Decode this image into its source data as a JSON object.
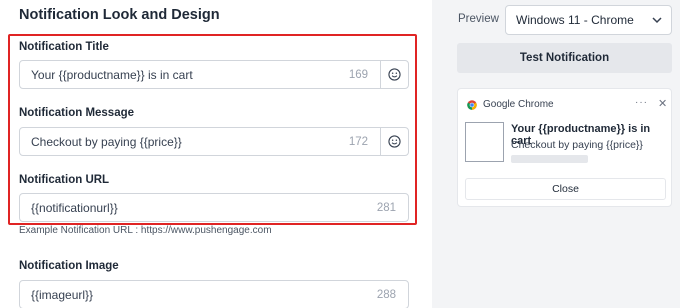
{
  "section_title": "Notification Look and Design",
  "fields": {
    "title": {
      "label": "Notification Title",
      "value": "Your {{productname}} is in cart",
      "count": "169"
    },
    "message": {
      "label": "Notification Message",
      "value": "Checkout by paying {{price}}",
      "count": "172"
    },
    "url": {
      "label": "Notification URL",
      "value": "{{notificationurl}}",
      "count": "281",
      "hint": "Example Notification URL : https://www.pushengage.com"
    },
    "image": {
      "label": "Notification Image",
      "value": "{{imageurl}}",
      "count": "288"
    }
  },
  "preview": {
    "label": "Preview",
    "selected": "Windows 11 - Chrome",
    "test_button": "Test Notification",
    "notification": {
      "browser": "Google Chrome",
      "title": "Your {{productname}} is in cart",
      "message": "Checkout by paying {{price}}",
      "close_label": "Close",
      "dots": "···",
      "close_glyph": "✕"
    }
  },
  "colors": {
    "highlight": "#e02424",
    "panel": "#f3f4f6"
  },
  "icons": [
    "emoji-icon",
    "chevron-down-icon",
    "chrome-icon",
    "more-icon",
    "close-icon",
    "broken-image-icon"
  ]
}
